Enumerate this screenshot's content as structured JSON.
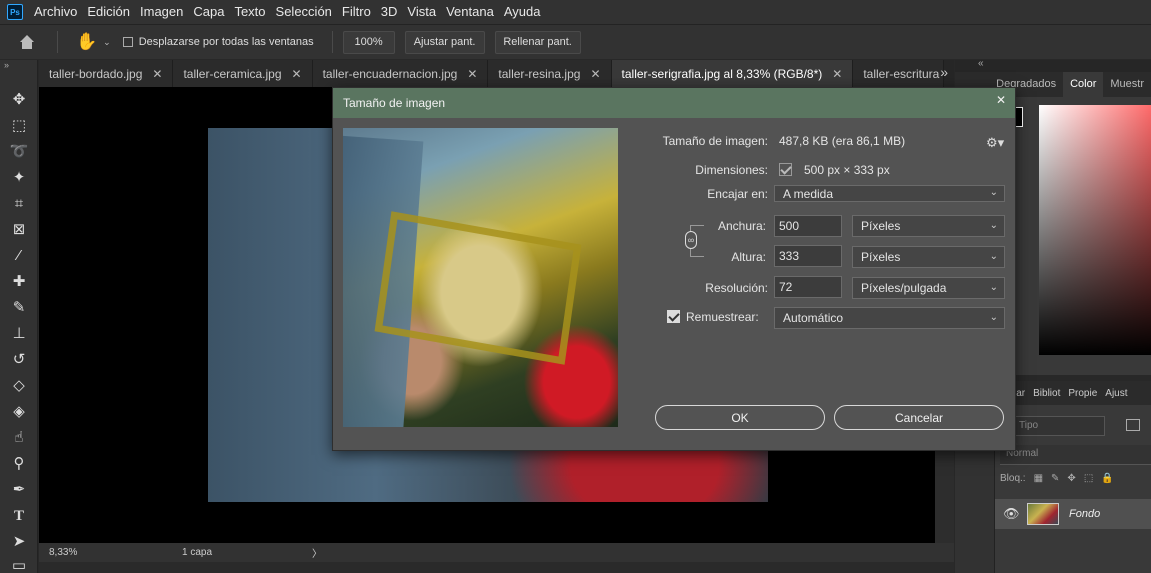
{
  "menu": [
    "Archivo",
    "Edición",
    "Imagen",
    "Capa",
    "Texto",
    "Selección",
    "Filtro",
    "3D",
    "Vista",
    "Ventana",
    "Ayuda"
  ],
  "app_logo": "Ps",
  "options": {
    "scroll_all_label": "Desplazarse por todas las ventanas",
    "zoom_button": "100%",
    "fit_button": "Ajustar pant.",
    "fill_button": "Rellenar pant."
  },
  "tabs": [
    {
      "label": "taller-bordado.jpg",
      "active": false
    },
    {
      "label": "taller-ceramica.jpg",
      "active": false
    },
    {
      "label": "taller-encuadernacion.jpg",
      "active": false
    },
    {
      "label": "taller-resina.jpg",
      "active": false
    },
    {
      "label": "taller-serigrafia.jpg al 8,33% (RGB/8*)",
      "active": true
    },
    {
      "label": "taller-escritura",
      "active": false
    }
  ],
  "status": {
    "zoom": "8,33%",
    "info": "1 capa"
  },
  "right_panel": {
    "tabs": [
      "Degradados",
      "Color",
      "Muestr"
    ],
    "active_tab": "Color",
    "layer_tabs": [
      "ormar",
      "Bibliot",
      "Propie",
      "Ajust"
    ],
    "filter_placeholder": "Tipo",
    "blend_mode": "Normal",
    "lock_label": "Bloq.:",
    "layer_name": "Fondo"
  },
  "dialog": {
    "title": "Tamaño de imagen",
    "image_size_label": "Tamaño de imagen:",
    "image_size_value": "487,8 KB (era 86,1 MB)",
    "dimensions_label": "Dimensiones:",
    "dimensions_value": "500 px × 333 px",
    "fit_label": "Encajar en:",
    "fit_value": "A medida",
    "width_label": "Anchura:",
    "width_value": "500",
    "width_unit": "Píxeles",
    "height_label": "Altura:",
    "height_value": "333",
    "height_unit": "Píxeles",
    "resolution_label": "Resolución:",
    "resolution_value": "72",
    "resolution_unit": "Píxeles/pulgada",
    "resample_label": "Remuestrear:",
    "resample_value": "Automático",
    "ok_label": "OK",
    "cancel_label": "Cancelar"
  }
}
